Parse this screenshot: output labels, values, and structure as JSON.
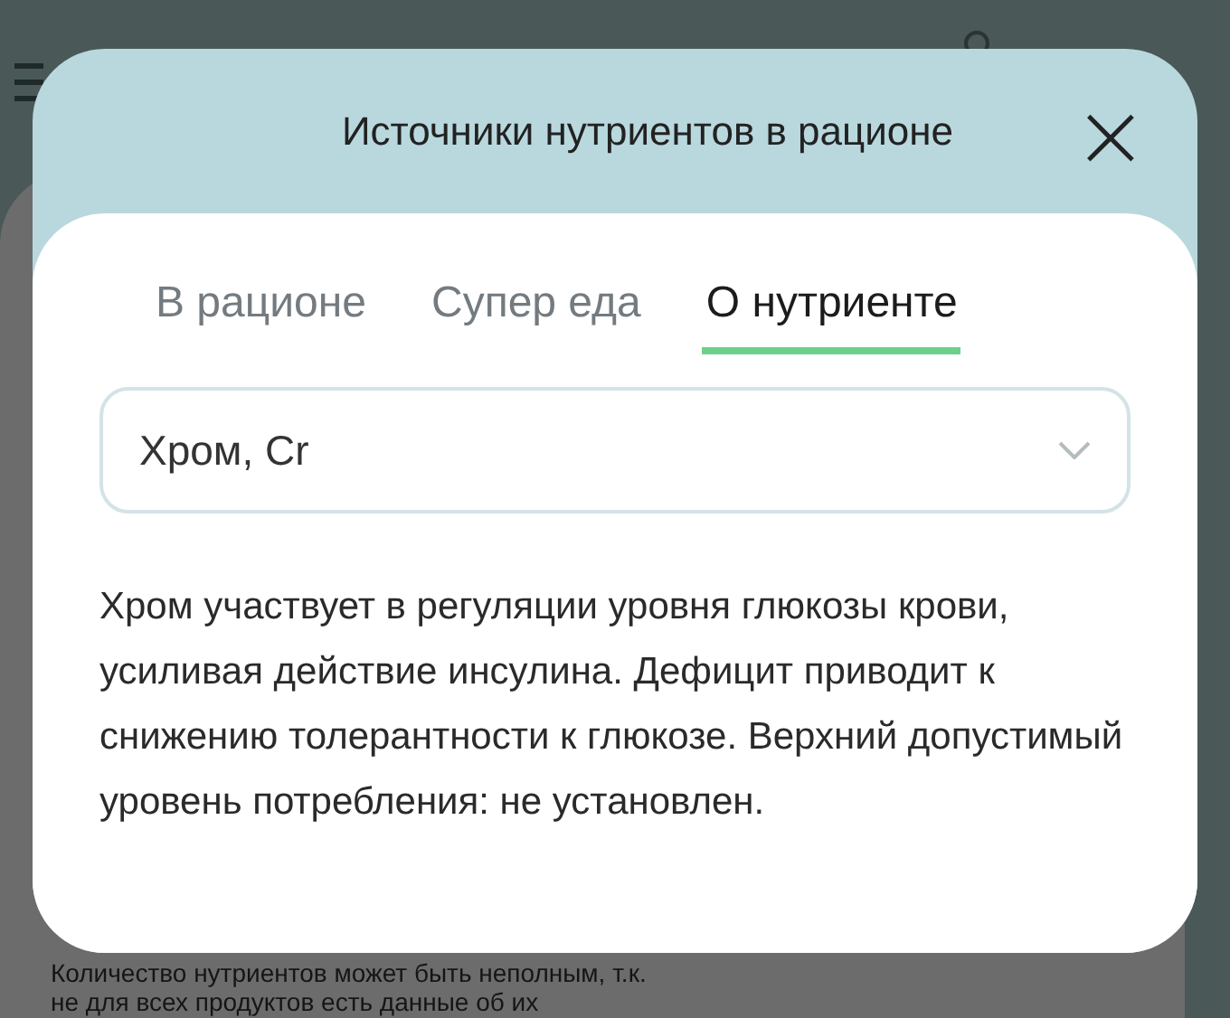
{
  "background": {
    "notice_lines": [
      "Количество нутриентов может быть неполным, т.к.",
      "не для всех продуктов есть данные об их"
    ]
  },
  "dialog": {
    "title": "Источники нутриентов в рационе",
    "close": "×"
  },
  "tabs": [
    {
      "label": "В рационе",
      "selected": false
    },
    {
      "label": "Супер еда",
      "selected": false
    },
    {
      "label": "О нутриенте",
      "selected": true
    }
  ],
  "nutrient_select": {
    "value": "Хром, Cr"
  },
  "description": "Хром участвует в регуляции уровня глюкозы крови, усиливая действие инсулина. Дефицит приводит к снижению толерантности к глюкозе. Верхний допустимый уровень потребления: не установлен."
}
